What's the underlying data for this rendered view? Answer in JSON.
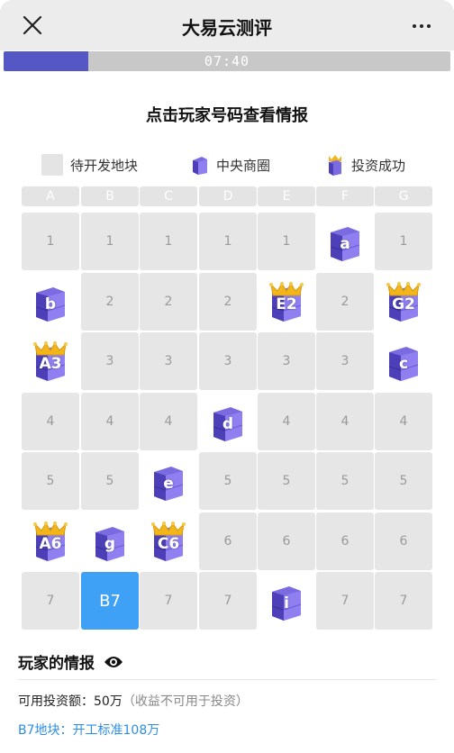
{
  "header": {
    "title": "大易云测评"
  },
  "progress": {
    "fraction": 0.19,
    "timer": "07:40"
  },
  "subtitle": "点击玩家号码查看情报",
  "legend": [
    {
      "label": "待开发地块",
      "icon": "empty-lot-swatch"
    },
    {
      "label": "中央商圈",
      "icon": "building-icon"
    },
    {
      "label": "投资成功",
      "icon": "crowned-building-icon"
    }
  ],
  "columns": [
    "A",
    "B",
    "C",
    "D",
    "E",
    "F",
    "G"
  ],
  "grid": [
    [
      {
        "t": "num",
        "v": "1"
      },
      {
        "t": "num",
        "v": "1"
      },
      {
        "t": "num",
        "v": "1"
      },
      {
        "t": "num",
        "v": "1"
      },
      {
        "t": "num",
        "v": "1"
      },
      {
        "t": "bldg",
        "v": "a"
      },
      {
        "t": "num",
        "v": "1"
      }
    ],
    [
      {
        "t": "bldg",
        "v": "b"
      },
      {
        "t": "num",
        "v": "2"
      },
      {
        "t": "num",
        "v": "2"
      },
      {
        "t": "num",
        "v": "2"
      },
      {
        "t": "crown",
        "v": "E2"
      },
      {
        "t": "num",
        "v": "2"
      },
      {
        "t": "crown",
        "v": "G2"
      }
    ],
    [
      {
        "t": "crown",
        "v": "A3"
      },
      {
        "t": "num",
        "v": "3"
      },
      {
        "t": "num",
        "v": "3"
      },
      {
        "t": "num",
        "v": "3"
      },
      {
        "t": "num",
        "v": "3"
      },
      {
        "t": "num",
        "v": "3"
      },
      {
        "t": "bldg",
        "v": "c"
      }
    ],
    [
      {
        "t": "num",
        "v": "4"
      },
      {
        "t": "num",
        "v": "4"
      },
      {
        "t": "num",
        "v": "4"
      },
      {
        "t": "bldg",
        "v": "d"
      },
      {
        "t": "num",
        "v": "4"
      },
      {
        "t": "num",
        "v": "4"
      },
      {
        "t": "num",
        "v": "4"
      }
    ],
    [
      {
        "t": "num",
        "v": "5"
      },
      {
        "t": "num",
        "v": "5"
      },
      {
        "t": "bldg",
        "v": "e"
      },
      {
        "t": "num",
        "v": "5"
      },
      {
        "t": "num",
        "v": "5"
      },
      {
        "t": "num",
        "v": "5"
      },
      {
        "t": "num",
        "v": "5"
      }
    ],
    [
      {
        "t": "crown",
        "v": "A6"
      },
      {
        "t": "bldg",
        "v": "g"
      },
      {
        "t": "crown",
        "v": "C6"
      },
      {
        "t": "num",
        "v": "6"
      },
      {
        "t": "num",
        "v": "6"
      },
      {
        "t": "num",
        "v": "6"
      },
      {
        "t": "num",
        "v": "6"
      }
    ],
    [
      {
        "t": "num",
        "v": "7"
      },
      {
        "t": "selected",
        "v": "B7"
      },
      {
        "t": "num",
        "v": "7"
      },
      {
        "t": "num",
        "v": "7"
      },
      {
        "t": "bldg",
        "v": "i"
      },
      {
        "t": "num",
        "v": "7"
      },
      {
        "t": "num",
        "v": "7"
      }
    ]
  ],
  "info": {
    "title": "玩家的情报",
    "line1_label": "可用投资额：50万",
    "line1_note": "（收益不可用于投资）",
    "line2": "B7地块：开工标准108万"
  },
  "colors": {
    "accent": "#5457c4",
    "selected": "#3ea1f5",
    "building": "#7b6be0",
    "crown": "#f2b51c",
    "info_blue": "#2c8de6"
  }
}
